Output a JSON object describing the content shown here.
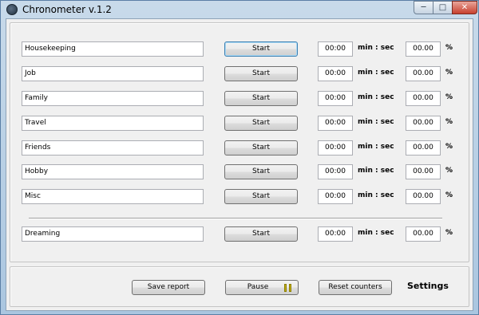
{
  "window": {
    "title": "Chronometer  v.1.2",
    "controls": {
      "minimize": "─",
      "maximize": "□",
      "close": "✕"
    }
  },
  "activities": [
    {
      "name": "Housekeeping",
      "button": "Start",
      "time": "00:00",
      "unit": "min : sec",
      "percent": "00.00",
      "percent_sign": "%"
    },
    {
      "name": "Job",
      "button": "Start",
      "time": "00:00",
      "unit": "min : sec",
      "percent": "00.00",
      "percent_sign": "%"
    },
    {
      "name": "Family",
      "button": "Start",
      "time": "00:00",
      "unit": "min : sec",
      "percent": "00.00",
      "percent_sign": "%"
    },
    {
      "name": "Travel",
      "button": "Start",
      "time": "00:00",
      "unit": "min : sec",
      "percent": "00.00",
      "percent_sign": "%"
    },
    {
      "name": "Friends",
      "button": "Start",
      "time": "00:00",
      "unit": "min : sec",
      "percent": "00.00",
      "percent_sign": "%"
    },
    {
      "name": "Hobby",
      "button": "Start",
      "time": "00:00",
      "unit": "min : sec",
      "percent": "00.00",
      "percent_sign": "%"
    },
    {
      "name": "Misc",
      "button": "Start",
      "time": "00:00",
      "unit": "min : sec",
      "percent": "00.00",
      "percent_sign": "%"
    }
  ],
  "dreaming": {
    "name": "Dreaming",
    "button": "Start",
    "time": "00:00",
    "unit": "min : sec",
    "percent": "00.00",
    "percent_sign": "%"
  },
  "footer": {
    "save_report": "Save report",
    "pause": "Pause",
    "reset_counters": "Reset counters",
    "settings": "Settings"
  },
  "colors": {
    "title_bar": "#aac6e0",
    "pause_icon": "#c4b000",
    "focused_button_border": "#3c7fb1"
  }
}
